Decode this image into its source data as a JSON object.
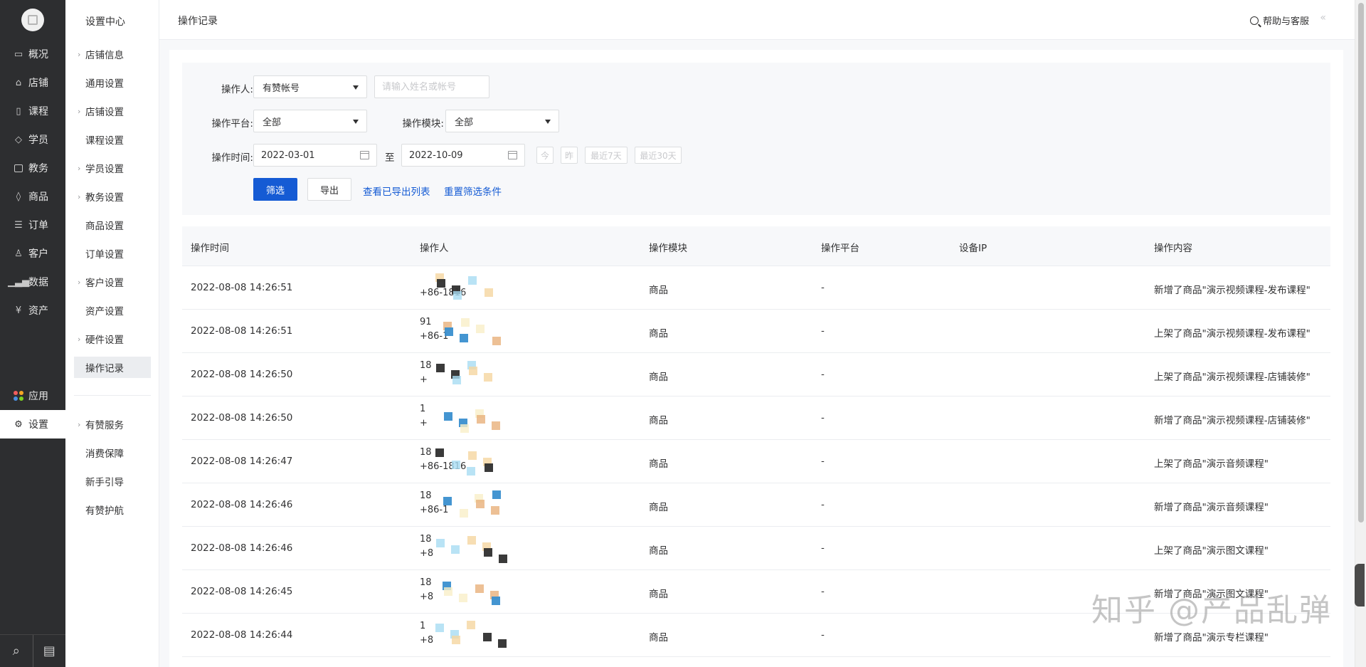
{
  "primary_nav": {
    "items": [
      {
        "label": "概况",
        "icon": "monitor-icon"
      },
      {
        "label": "店铺",
        "icon": "store-icon"
      },
      {
        "label": "课程",
        "icon": "book-icon"
      },
      {
        "label": "学员",
        "icon": "graduation-cap-icon"
      },
      {
        "label": "教务",
        "icon": "briefcase-icon"
      },
      {
        "label": "商品",
        "icon": "tag-icon"
      },
      {
        "label": "订单",
        "icon": "document-icon"
      },
      {
        "label": "客户",
        "icon": "user-icon"
      },
      {
        "label": "数据",
        "icon": "bar-chart-icon"
      },
      {
        "label": "资产",
        "icon": "currency-icon"
      }
    ],
    "apps_label": "应用",
    "settings_label": "设置",
    "bottom_search_icon": "search-icon",
    "bottom_chat_icon": "chat-icon"
  },
  "secondary_nav": {
    "title": "设置中心",
    "items": [
      {
        "label": "店铺信息",
        "expandable": true
      },
      {
        "label": "通用设置",
        "expandable": false
      },
      {
        "label": "店铺设置",
        "expandable": true
      },
      {
        "label": "课程设置",
        "expandable": false
      },
      {
        "label": "学员设置",
        "expandable": true
      },
      {
        "label": "教务设置",
        "expandable": true
      },
      {
        "label": "商品设置",
        "expandable": false
      },
      {
        "label": "订单设置",
        "expandable": false
      },
      {
        "label": "客户设置",
        "expandable": true
      },
      {
        "label": "资产设置",
        "expandable": false
      },
      {
        "label": "硬件设置",
        "expandable": true
      },
      {
        "label": "操作记录",
        "expandable": false,
        "active": true
      }
    ],
    "items2": [
      {
        "label": "有赞服务",
        "expandable": true
      },
      {
        "label": "消费保障",
        "expandable": false
      },
      {
        "label": "新手引导",
        "expandable": false
      },
      {
        "label": "有赞护航",
        "expandable": false
      }
    ]
  },
  "header": {
    "title": "操作记录",
    "help_label": "帮助与客服",
    "collapse_glyph": "«"
  },
  "filters": {
    "operator_label": "操作人:",
    "operator_type": "有赞帐号",
    "operator_placeholder": "请输入姓名或帐号",
    "platform_label": "操作平台:",
    "platform_value": "全部",
    "module_label": "操作模块:",
    "module_value": "全部",
    "time_label": "操作时间:",
    "start_date": "2022-03-01",
    "range_sep": "至",
    "end_date": "2022-10-09",
    "quick": [
      "今",
      "昨",
      "最近7天",
      "最近30天"
    ],
    "filter_button": "筛选",
    "export_button": "导出",
    "view_exports_link": "查看已导出列表",
    "reset_link": "重置筛选条件"
  },
  "table": {
    "columns": [
      "操作时间",
      "操作人",
      "操作模块",
      "操作平台",
      "设备IP",
      "操作内容"
    ],
    "rows": [
      {
        "time": "2022-08-08 14:26:51",
        "op1": "",
        "op2": "+86-1816",
        "module": "商品",
        "platform": "-",
        "ip": "",
        "content": "新增了商品\"演示视频课程-发布课程\""
      },
      {
        "time": "2022-08-08 14:26:51",
        "op1": "91",
        "op2": "+86-1",
        "module": "商品",
        "platform": "-",
        "ip": "",
        "content": "上架了商品\"演示视频课程-发布课程\""
      },
      {
        "time": "2022-08-08 14:26:50",
        "op1": "18",
        "op2": "+",
        "module": "商品",
        "platform": "-",
        "ip": "",
        "content": "上架了商品\"演示视频课程-店铺装修\""
      },
      {
        "time": "2022-08-08 14:26:50",
        "op1": "1",
        "op2": "+",
        "module": "商品",
        "platform": "-",
        "ip": "",
        "content": "新增了商品\"演示视频课程-店铺装修\""
      },
      {
        "time": "2022-08-08 14:26:47",
        "op1": "18",
        "op2": "+86-1816",
        "module": "商品",
        "platform": "-",
        "ip": "",
        "content": "上架了商品\"演示音频课程\""
      },
      {
        "time": "2022-08-08 14:26:46",
        "op1": "18",
        "op2": "+86-1",
        "module": "商品",
        "platform": "-",
        "ip": "",
        "content": "新增了商品\"演示音频课程\""
      },
      {
        "time": "2022-08-08 14:26:46",
        "op1": "18",
        "op2": "+8",
        "module": "商品",
        "platform": "-",
        "ip": "",
        "content": "上架了商品\"演示图文课程\""
      },
      {
        "time": "2022-08-08 14:26:45",
        "op1": "18",
        "op2": "+8",
        "module": "商品",
        "platform": "-",
        "ip": "",
        "content": "新增了商品\"演示图文课程\""
      },
      {
        "time": "2022-08-08 14:26:44",
        "op1": "1",
        "op2": "+8",
        "module": "商品",
        "platform": "-",
        "ip": "",
        "content": "新增了商品\"演示专栏课程\""
      }
    ]
  },
  "watermark": "知乎 @产品乱弹",
  "colors": {
    "accent": "#155bd4",
    "sidebar_bg": "#2d2e30"
  }
}
